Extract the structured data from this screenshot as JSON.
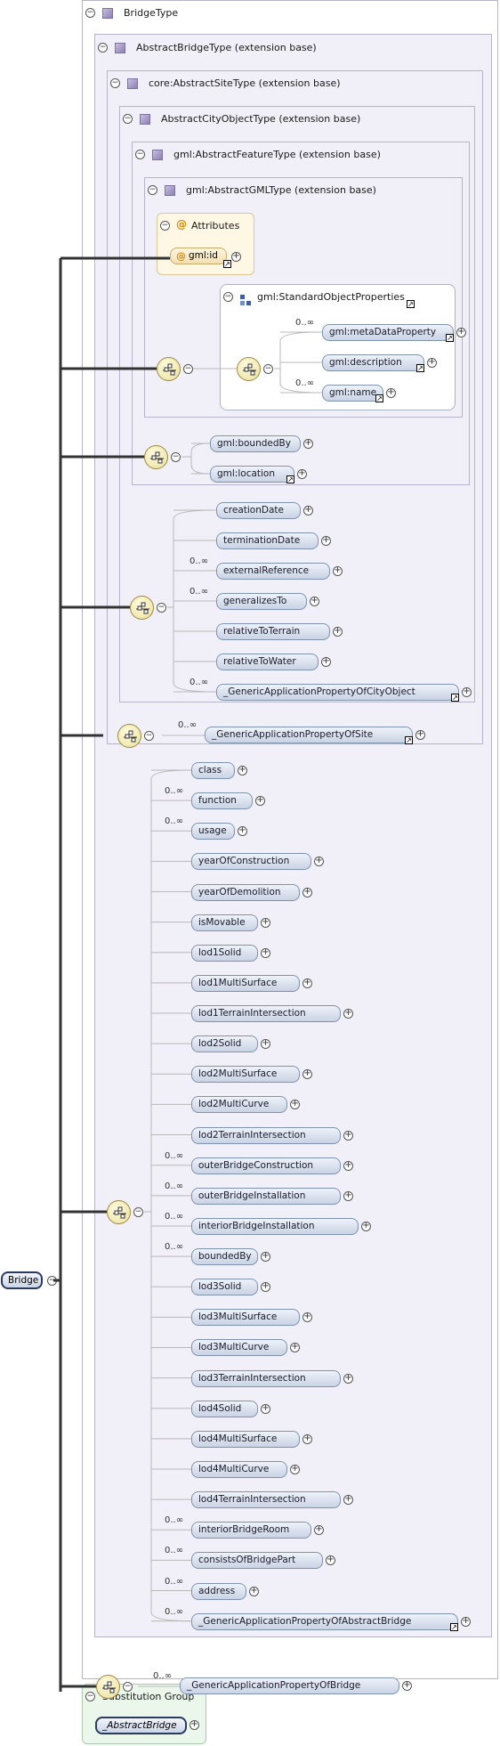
{
  "diagram": {
    "root_type": "BridgeType",
    "bases": {
      "abstract_bridge": "AbstractBridgeType (extension base)",
      "abstract_site": "core:AbstractSiteType (extension base)",
      "abstract_city_object": "AbstractCityObjectType (extension base)",
      "abstract_feature": "gml:AbstractFeatureType (extension base)",
      "abstract_gml": "gml:AbstractGMLType (extension base)"
    },
    "attributes": {
      "title": "Attributes",
      "id": "gml:id"
    },
    "standard_object_properties": {
      "title": "gml:StandardObjectProperties",
      "elements": [
        {
          "label": "gml:metaDataProperty",
          "occ": "0..∞"
        },
        {
          "label": "gml:description",
          "occ": ""
        },
        {
          "label": "gml:name",
          "occ": "0..∞"
        }
      ]
    },
    "feature_elements": [
      {
        "label": "gml:boundedBy",
        "occ": ""
      },
      {
        "label": "gml:location",
        "occ": ""
      }
    ],
    "city_object_elements": [
      {
        "label": "creationDate",
        "occ": ""
      },
      {
        "label": "terminationDate",
        "occ": ""
      },
      {
        "label": "externalReference",
        "occ": "0..∞"
      },
      {
        "label": "generalizesTo",
        "occ": "0..∞"
      },
      {
        "label": "relativeToTerrain",
        "occ": ""
      },
      {
        "label": "relativeToWater",
        "occ": ""
      },
      {
        "label": "_GenericApplicationPropertyOfCityObject",
        "occ": "0..∞"
      }
    ],
    "site_element": {
      "label": "_GenericApplicationPropertyOfSite",
      "occ": "0..∞"
    },
    "bridge_elements": [
      {
        "label": "class",
        "occ": ""
      },
      {
        "label": "function",
        "occ": "0..∞"
      },
      {
        "label": "usage",
        "occ": "0..∞"
      },
      {
        "label": "yearOfConstruction",
        "occ": ""
      },
      {
        "label": "yearOfDemolition",
        "occ": ""
      },
      {
        "label": "isMovable",
        "occ": ""
      },
      {
        "label": "lod1Solid",
        "occ": ""
      },
      {
        "label": "lod1MultiSurface",
        "occ": ""
      },
      {
        "label": "lod1TerrainIntersection",
        "occ": ""
      },
      {
        "label": "lod2Solid",
        "occ": ""
      },
      {
        "label": "lod2MultiSurface",
        "occ": ""
      },
      {
        "label": "lod2MultiCurve",
        "occ": ""
      },
      {
        "label": "lod2TerrainIntersection",
        "occ": ""
      },
      {
        "label": "outerBridgeConstruction",
        "occ": "0..∞"
      },
      {
        "label": "outerBridgeInstallation",
        "occ": "0..∞"
      },
      {
        "label": "interiorBridgeInstallation",
        "occ": "0..∞"
      },
      {
        "label": "boundedBy",
        "occ": "0..∞"
      },
      {
        "label": "lod3Solid",
        "occ": ""
      },
      {
        "label": "lod3MultiSurface",
        "occ": ""
      },
      {
        "label": "lod3MultiCurve",
        "occ": ""
      },
      {
        "label": "lod3TerrainIntersection",
        "occ": ""
      },
      {
        "label": "lod4Solid",
        "occ": ""
      },
      {
        "label": "lod4MultiSurface",
        "occ": ""
      },
      {
        "label": "lod4MultiCurve",
        "occ": ""
      },
      {
        "label": "lod4TerrainIntersection",
        "occ": ""
      },
      {
        "label": "interiorBridgeRoom",
        "occ": "0..∞"
      },
      {
        "label": "consistsOfBridgePart",
        "occ": "0..∞"
      },
      {
        "label": "address",
        "occ": "0..∞"
      },
      {
        "label": "_GenericApplicationPropertyOfAbstractBridge",
        "occ": "0..∞"
      }
    ],
    "bridge_type_element": {
      "label": "_GenericApplicationPropertyOfBridge",
      "occ": "0..∞"
    },
    "root_element": "Bridge",
    "substitution_group": {
      "title": "Substitution Group",
      "member": "_AbstractBridge"
    },
    "symbols": {
      "minus": "−",
      "plus": "+",
      "ref": "↗",
      "at": "@"
    }
  }
}
